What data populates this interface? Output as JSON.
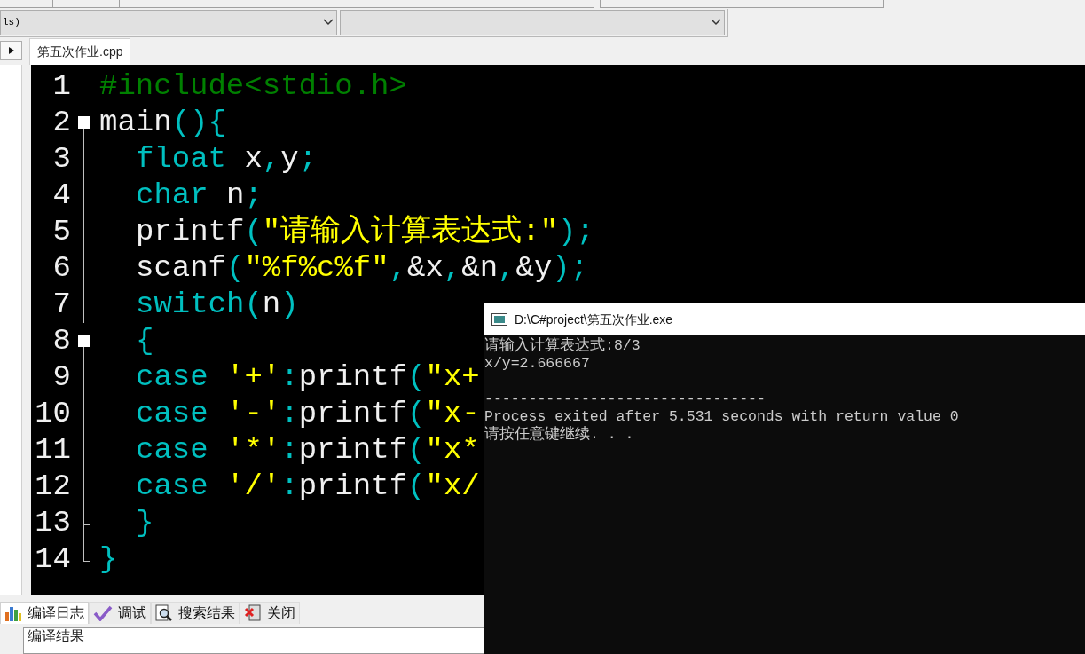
{
  "toolbar": {
    "combo_boxes": [
      {
        "value": "ls)"
      }
    ]
  },
  "editor": {
    "file_tab": {
      "label": "第五次作业.cpp",
      "selected": true
    },
    "lines": [
      {
        "number": "1",
        "kind": "plain",
        "indented": false,
        "tokens": [
          {
            "kind": "preprocessor",
            "text": "#include<stdio.h>"
          }
        ]
      },
      {
        "number": "2",
        "kind": "fold_start",
        "indented": false,
        "tokens": [
          {
            "kind": "plain",
            "text": "main"
          },
          {
            "kind": "symbol",
            "text": "(){"
          }
        ]
      },
      {
        "number": "3",
        "kind": "fold_body",
        "indented": true,
        "tokens": [
          {
            "kind": "keyword",
            "text": "float"
          },
          {
            "kind": "plain",
            "text": " x"
          },
          {
            "kind": "symbol",
            "text": ","
          },
          {
            "kind": "plain",
            "text": "y"
          },
          {
            "kind": "symbol",
            "text": ";"
          }
        ]
      },
      {
        "number": "4",
        "kind": "fold_body",
        "indented": true,
        "tokens": [
          {
            "kind": "keyword",
            "text": "char"
          },
          {
            "kind": "plain",
            "text": " n"
          },
          {
            "kind": "symbol",
            "text": ";"
          }
        ]
      },
      {
        "number": "5",
        "kind": "fold_body",
        "indented": true,
        "tokens": [
          {
            "kind": "plain",
            "text": "printf"
          },
          {
            "kind": "symbol",
            "text": "("
          },
          {
            "kind": "string",
            "text": "\"请输入计算表达式:\""
          },
          {
            "kind": "symbol",
            "text": ");"
          }
        ]
      },
      {
        "number": "6",
        "kind": "fold_body",
        "indented": true,
        "tokens": [
          {
            "kind": "plain",
            "text": "scanf"
          },
          {
            "kind": "symbol",
            "text": "("
          },
          {
            "kind": "string",
            "text": "\"%f%c%f\""
          },
          {
            "kind": "symbol",
            "text": ","
          },
          {
            "kind": "plain",
            "text": "&x"
          },
          {
            "kind": "symbol",
            "text": ","
          },
          {
            "kind": "plain",
            "text": "&n"
          },
          {
            "kind": "symbol",
            "text": ","
          },
          {
            "kind": "plain",
            "text": "&y"
          },
          {
            "kind": "symbol",
            "text": ");"
          }
        ]
      },
      {
        "number": "7",
        "kind": "fold_body",
        "indented": true,
        "tokens": [
          {
            "kind": "keyword",
            "text": "switch"
          },
          {
            "kind": "symbol",
            "text": "("
          },
          {
            "kind": "plain",
            "text": "n"
          },
          {
            "kind": "symbol",
            "text": ")"
          }
        ]
      },
      {
        "number": "8",
        "kind": "fold_start",
        "indented": true,
        "tokens": [
          {
            "kind": "symbol",
            "text": "{"
          }
        ]
      },
      {
        "number": "9",
        "kind": "fold_body",
        "indented": true,
        "tokens": [
          {
            "kind": "keyword",
            "text": "case"
          },
          {
            "kind": "string",
            "text": " '+'"
          },
          {
            "kind": "symbol",
            "text": ":"
          },
          {
            "kind": "plain",
            "text": "printf"
          },
          {
            "kind": "symbol",
            "text": "("
          },
          {
            "kind": "string",
            "text": "\"x+"
          }
        ]
      },
      {
        "number": "10",
        "kind": "fold_body",
        "indented": true,
        "tokens": [
          {
            "kind": "keyword",
            "text": "case"
          },
          {
            "kind": "string",
            "text": " '-'"
          },
          {
            "kind": "symbol",
            "text": ":"
          },
          {
            "kind": "plain",
            "text": "printf"
          },
          {
            "kind": "symbol",
            "text": "("
          },
          {
            "kind": "string",
            "text": "\"x-"
          }
        ]
      },
      {
        "number": "11",
        "kind": "fold_body",
        "indented": true,
        "tokens": [
          {
            "kind": "keyword",
            "text": "case"
          },
          {
            "kind": "string",
            "text": " '*'"
          },
          {
            "kind": "symbol",
            "text": ":"
          },
          {
            "kind": "plain",
            "text": "printf"
          },
          {
            "kind": "symbol",
            "text": "("
          },
          {
            "kind": "string",
            "text": "\"x*"
          }
        ]
      },
      {
        "number": "12",
        "kind": "fold_body",
        "indented": true,
        "tokens": [
          {
            "kind": "keyword",
            "text": "case"
          },
          {
            "kind": "string",
            "text": " '/'"
          },
          {
            "kind": "symbol",
            "text": ":"
          },
          {
            "kind": "plain",
            "text": "printf"
          },
          {
            "kind": "symbol",
            "text": "("
          },
          {
            "kind": "string",
            "text": "\"x/"
          }
        ]
      },
      {
        "number": "13",
        "kind": "fold_close",
        "indented": true,
        "tokens": [
          {
            "kind": "symbol",
            "text": "}"
          }
        ]
      },
      {
        "number": "14",
        "kind": "fold_end",
        "indented": false,
        "tokens": [
          {
            "kind": "symbol",
            "text": "}"
          }
        ]
      }
    ]
  },
  "console": {
    "title": "D:\\C#project\\第五次作业.exe",
    "lines": [
      {
        "kind": "output",
        "text": "请输入计算表达式:8/3"
      },
      {
        "kind": "output",
        "text": "x/y=2.666667"
      },
      {
        "kind": "separator",
        "text": "--------------------------------"
      },
      {
        "kind": "output",
        "text": "Process exited after 5.531 seconds with return value 0"
      },
      {
        "kind": "output",
        "text": "请按任意键继续. . ."
      }
    ]
  },
  "bottom_tabs": [
    {
      "label": "编译日志",
      "selected": true
    },
    {
      "label": "调试",
      "selected": false
    },
    {
      "label": "搜索结果",
      "selected": false
    },
    {
      "label": "关闭",
      "selected": false
    }
  ],
  "log_panel": {
    "heading": "编译结果"
  }
}
